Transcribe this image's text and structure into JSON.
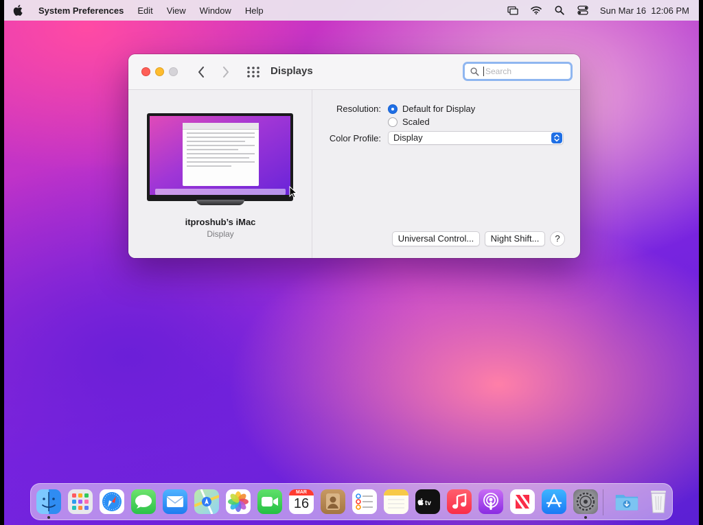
{
  "menubar": {
    "app_name": "System Preferences",
    "menus": [
      "Edit",
      "View",
      "Window",
      "Help"
    ],
    "clock": "Sun Mar 16  12:06 PM"
  },
  "window": {
    "title": "Displays",
    "search_placeholder": "Search",
    "display_name": "itproshub’s iMac",
    "display_type": "Display",
    "resolution_label": "Resolution:",
    "resolution_options": [
      "Default for Display",
      "Scaled"
    ],
    "resolution_selected": "Default for Display",
    "color_profile_label": "Color Profile:",
    "color_profile_value": "Display",
    "universal_control_button": "Universal Control...",
    "night_shift_button": "Night Shift...",
    "help_button": "?"
  },
  "dock": {
    "calendar_month": "MAR",
    "calendar_day": "16",
    "apps": [
      "finder",
      "launchpad",
      "safari",
      "messages",
      "mail",
      "maps",
      "photos",
      "facetime",
      "calendar",
      "contacts",
      "reminders",
      "notes",
      "apple-tv",
      "music",
      "podcasts",
      "news",
      "app-store",
      "system-preferences",
      "downloads",
      "trash"
    ]
  },
  "colors": {
    "accent": "#1f6fe5",
    "close": "#fe5f57",
    "minimize": "#febc2e"
  }
}
